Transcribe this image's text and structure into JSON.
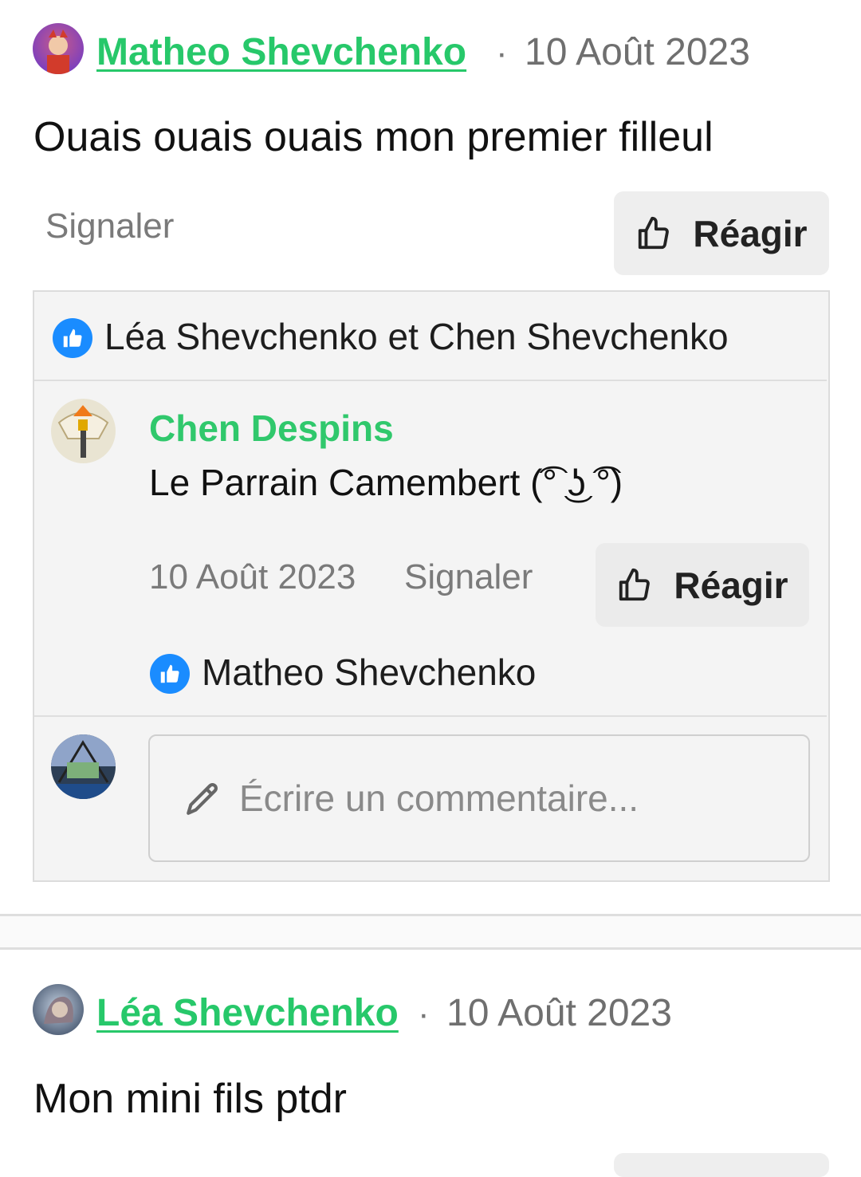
{
  "posts": [
    {
      "author": "Matheo Shevchenko",
      "separator": "·",
      "date": "10 Août 2023",
      "text": "Ouais ouais ouais mon premier filleul",
      "report_label": "Signaler",
      "react_label": "Réagir",
      "reactions_text": "Léa Shevchenko et Chen Shevchenko",
      "replies": [
        {
          "author": "Chen Despins",
          "text": "Le Parrain Camembert (͡° ͜ʖ ͡°)",
          "date": "10 Août 2023",
          "report_label": "Signaler",
          "react_label": "Réagir",
          "reactions_text": "Matheo Shevchenko"
        }
      ],
      "comment_placeholder": "Écrire un commentaire..."
    },
    {
      "author": "Léa Shevchenko",
      "separator": "·",
      "date": "10 Août 2023",
      "text": "Mon mini fils ptdr"
    }
  ],
  "icons": {
    "like": "thumbs-up-outline-icon",
    "like_badge": "thumbs-up-badge-icon",
    "edit": "pencil-icon"
  },
  "colors": {
    "author_green": "#27c86a",
    "like_blue": "#1a8cff"
  }
}
